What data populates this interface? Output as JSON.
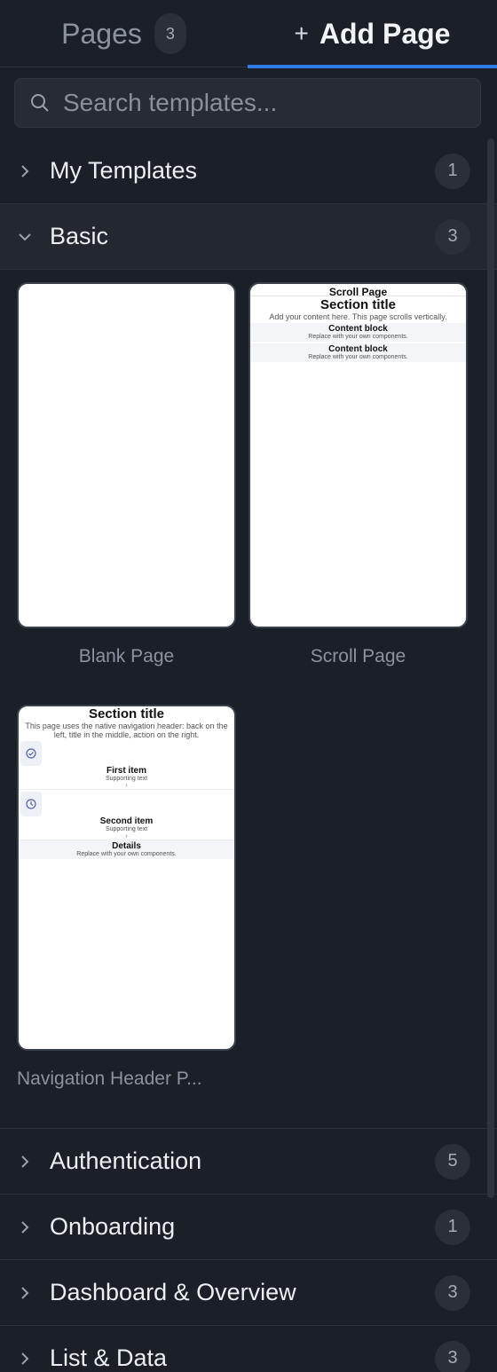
{
  "tabs": {
    "pages_label": "Pages",
    "pages_count": "3",
    "add_plus": "+",
    "add_label": "Add Page"
  },
  "search": {
    "placeholder": "Search templates..."
  },
  "colors": {
    "accent": "#2f7bea",
    "background": "#1b1f27",
    "panel": "#23272f"
  },
  "categories": {
    "my_templates": {
      "label": "My Templates",
      "count": "1"
    },
    "basic": {
      "label": "Basic",
      "count": "3"
    },
    "authentication": {
      "label": "Authentication",
      "count": "5"
    },
    "onboarding": {
      "label": "Onboarding",
      "count": "1"
    },
    "dashboard": {
      "label": "Dashboard & Overview",
      "count": "3"
    },
    "list_data": {
      "label": "List & Data",
      "count": "3"
    }
  },
  "templates": {
    "blank": {
      "label": "Blank Page"
    },
    "scroll": {
      "label": "Scroll Page",
      "preview": {
        "header": "Scroll Page",
        "title": "Section title",
        "desc": "Add your content here. This page scrolls vertically.",
        "block1_title": "Content block",
        "block1_sub": "Replace with your own components.",
        "block2_title": "Content block",
        "block2_sub": "Replace with your own components."
      }
    },
    "nav": {
      "label": "Navigation Header P...",
      "preview": {
        "title": "Section title",
        "desc": "This page uses the native navigation header: back on the left, title in the middle, action on the right.",
        "item1_title": "First item",
        "item1_sub": "Supporting text",
        "item2_title": "Second item",
        "item2_sub": "Supporting text",
        "chev": "›",
        "details_title": "Details",
        "details_sub": "Replace with your own components."
      }
    }
  }
}
